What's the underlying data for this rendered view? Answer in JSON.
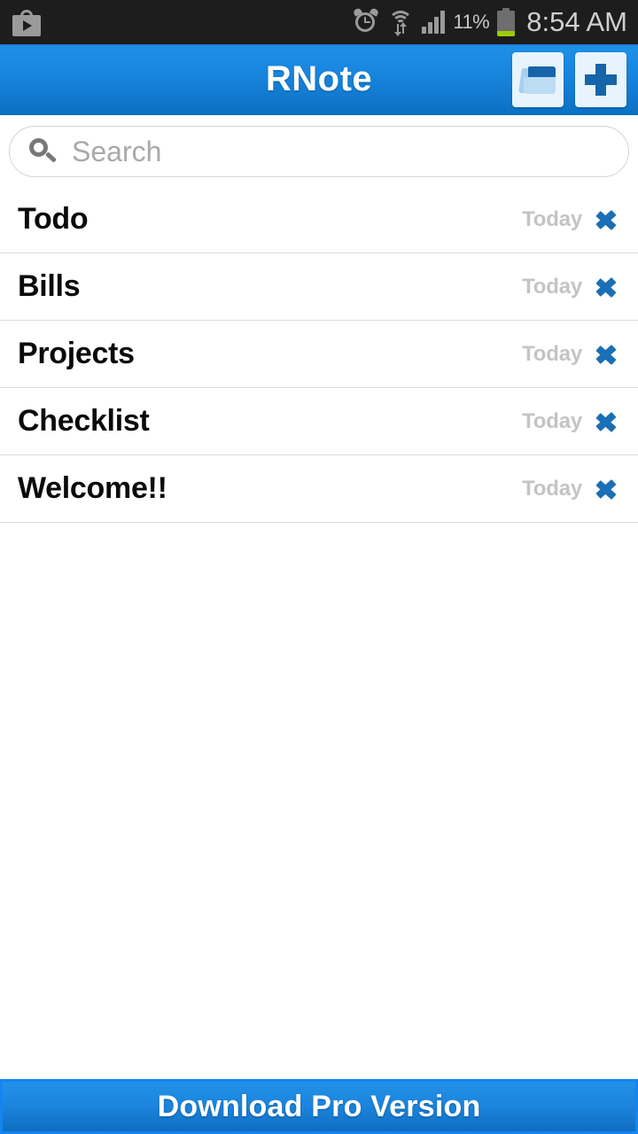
{
  "status_bar": {
    "notification_icon": "play-store-icon",
    "alarm_icon": "alarm-clock-icon",
    "wifi_icon": "wifi-transfer-icon",
    "signal_icon": "cellular-signal-icon",
    "battery_percent": "11%",
    "battery_icon": "battery-low-icon",
    "time": "8:54 AM",
    "background_color": "#1d1d1d",
    "icon_color": "#9a9a9a",
    "battery_fill_color": "#9ccb00"
  },
  "app_bar": {
    "title": "RNote",
    "folder_action": "folder-icon",
    "add_action": "plus-icon",
    "background_top_color": "#1e90e8",
    "background_bottom_color": "#0c71c4",
    "title_color": "#ffffff"
  },
  "search": {
    "placeholder": "Search",
    "value": "",
    "icon": "search-icon"
  },
  "notes": {
    "column_date_label": "Today",
    "chevron_color": "#1a6fb5",
    "items": [
      {
        "title": "Todo",
        "date": "Today"
      },
      {
        "title": "Bills",
        "date": "Today"
      },
      {
        "title": "Projects",
        "date": "Today"
      },
      {
        "title": "Checklist",
        "date": "Today"
      },
      {
        "title": "Welcome!!",
        "date": "Today"
      }
    ]
  },
  "banner": {
    "label": "Download Pro Version",
    "background_color": "#1b84dd",
    "text_color": "#ffffff"
  }
}
